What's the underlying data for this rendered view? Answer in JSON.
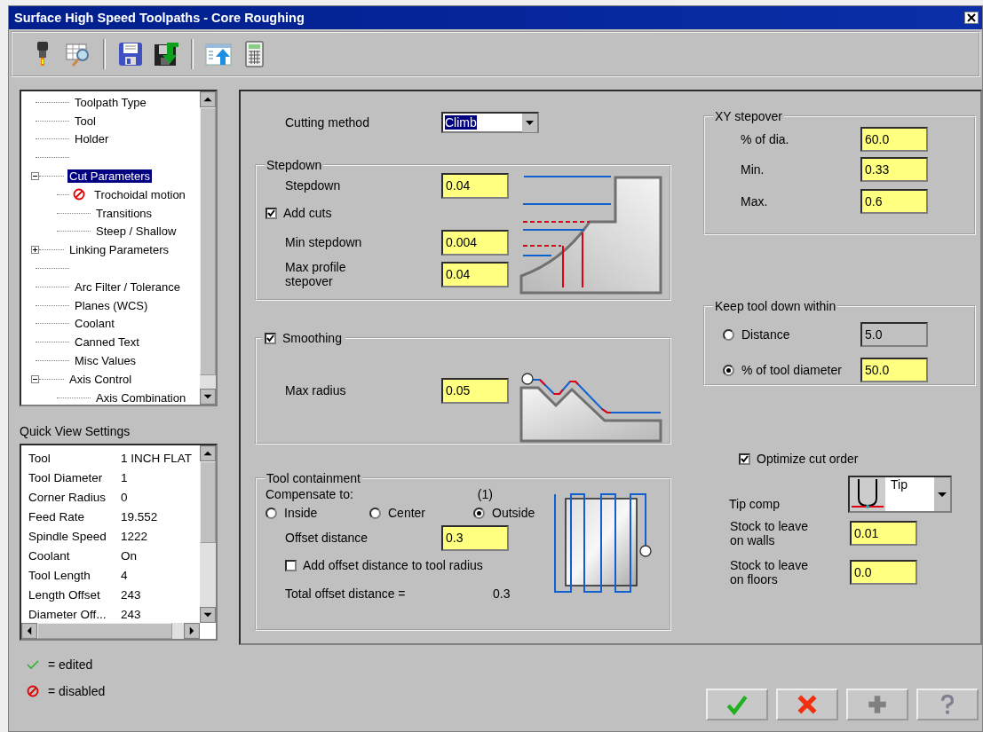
{
  "window": {
    "title": "Surface High Speed Toolpaths - Core Roughing"
  },
  "tree": {
    "items": [
      {
        "label": "Toolpath Type",
        "selected": false,
        "disabled": false
      },
      {
        "label": "Tool",
        "selected": false,
        "disabled": false
      },
      {
        "label": "Holder",
        "selected": false,
        "disabled": false
      },
      {
        "kind": "blank"
      },
      {
        "label": "Cut Parameters",
        "selected": true,
        "disabled": false,
        "expanded": true,
        "children": [
          {
            "label": "Trochoidal motion",
            "selected": false,
            "disabled": true
          },
          {
            "label": "Transitions",
            "selected": false,
            "disabled": false
          },
          {
            "label": "Steep / Shallow",
            "selected": false,
            "disabled": false
          }
        ]
      },
      {
        "label": "Linking Parameters",
        "selected": false,
        "disabled": false,
        "expanded": false
      },
      {
        "kind": "blank"
      },
      {
        "label": "Arc Filter / Tolerance",
        "selected": false,
        "disabled": false
      },
      {
        "label": "Planes (WCS)",
        "selected": false,
        "disabled": false
      },
      {
        "label": "Coolant",
        "selected": false,
        "disabled": false
      },
      {
        "label": "Canned Text",
        "selected": false,
        "disabled": false
      },
      {
        "label": "Misc Values",
        "selected": false,
        "disabled": false
      },
      {
        "label": "Axis Control",
        "selected": false,
        "disabled": false,
        "expanded": true,
        "children": [
          {
            "label": "Axis Combination",
            "selected": false,
            "disabled": false
          }
        ]
      }
    ]
  },
  "quick_view": {
    "title": "Quick View Settings",
    "rows": [
      {
        "name": "Tool",
        "value": "1 INCH FLAT"
      },
      {
        "name": "Tool Diameter",
        "value": "1"
      },
      {
        "name": "Corner Radius",
        "value": "0"
      },
      {
        "name": "Feed Rate",
        "value": "19.552"
      },
      {
        "name": "Spindle Speed",
        "value": "1222"
      },
      {
        "name": "Coolant",
        "value": "On"
      },
      {
        "name": "Tool Length",
        "value": "4"
      },
      {
        "name": "Length Offset",
        "value": "243"
      },
      {
        "name": "Diameter Off...",
        "value": "243"
      }
    ]
  },
  "legend": [
    {
      "kind": "edited",
      "label": "= edited"
    },
    {
      "kind": "disabled",
      "label": "= disabled"
    }
  ],
  "cutting_method": {
    "label": "Cutting method",
    "value": "Climb"
  },
  "stepdown": {
    "title": "Stepdown",
    "stepdown": {
      "label": "Stepdown",
      "value": "0.04"
    },
    "add_cuts": {
      "label": "Add cuts",
      "checked": true
    },
    "min_stepdown": {
      "label": "Min stepdown",
      "value": "0.004"
    },
    "max_profile_stepover": {
      "label": "Max profile stepover",
      "value": "0.04"
    }
  },
  "smoothing": {
    "label": "Smoothing",
    "checked": true,
    "max_radius": {
      "label": "Max radius",
      "value": "0.05"
    }
  },
  "tool_containment": {
    "title": "Tool containment",
    "compensate_label": "Compensate to:",
    "compensate_note": "(1)",
    "options": [
      {
        "label": "Inside",
        "selected": false
      },
      {
        "label": "Center",
        "selected": false
      },
      {
        "label": "Outside",
        "selected": true
      }
    ],
    "offset_distance": {
      "label": "Offset distance",
      "value": "0.3"
    },
    "add_offset": {
      "label": "Add offset distance to tool radius",
      "checked": false
    },
    "total_label": "Total offset distance =",
    "total_value": "0.3"
  },
  "xy_stepover": {
    "title": "XY stepover",
    "fields": [
      {
        "label": "% of dia.",
        "value": "60.0"
      },
      {
        "label": "Min.",
        "value": "0.33"
      },
      {
        "label": "Max.",
        "value": "0.6"
      }
    ]
  },
  "keep_tool_down": {
    "title": "Keep tool down within",
    "options": [
      {
        "label": "Distance",
        "selected": false,
        "value": "5.0"
      },
      {
        "label": "% of tool diameter",
        "selected": true,
        "value": "50.0"
      }
    ]
  },
  "optimize_cut_order": {
    "label": "Optimize cut order",
    "checked": true
  },
  "tip_comp": {
    "label": "Tip comp",
    "value": "Tip"
  },
  "stock": [
    {
      "label": "Stock to leave on walls",
      "value": "0.01"
    },
    {
      "label": "Stock to leave on floors",
      "value": "0.0"
    }
  ],
  "buttons": [
    {
      "kind": "ok"
    },
    {
      "kind": "cancel"
    },
    {
      "kind": "add"
    },
    {
      "kind": "help"
    }
  ]
}
